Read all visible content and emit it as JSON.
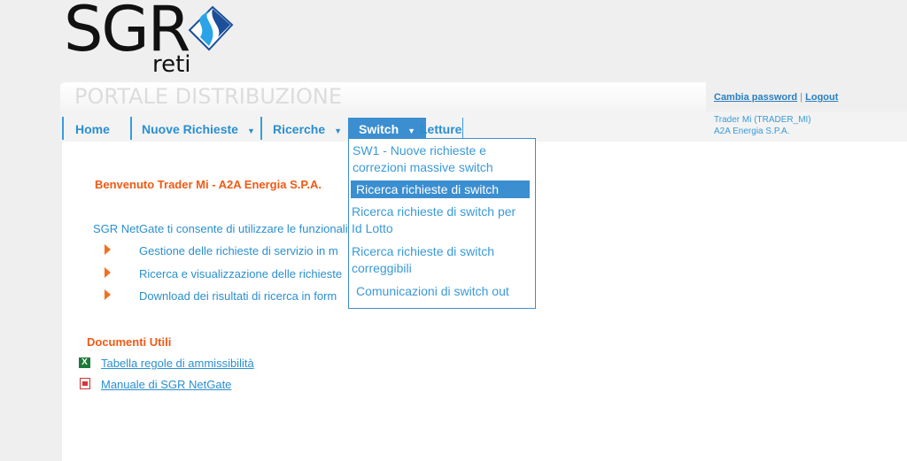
{
  "logo": {
    "text": "SGR",
    "subtext": "reti"
  },
  "header": {
    "portal_title": "PORTALE DISTRIBUZIONE",
    "change_password": "Cambia password",
    "separator": "|",
    "logout": "Logout",
    "user_name": "Trader Mi (TRADER_MI)",
    "company": "A2A Energia S.P.A."
  },
  "nav": {
    "home": "Home",
    "nuove": "Nuove Richieste",
    "ricerche": "Ricerche",
    "switch": "Switch",
    "letture": "Letture"
  },
  "switch_menu": [
    "SW1 - Nuove richieste e correzioni massive switch",
    "Ricerca richieste di switch",
    "Ricerca richieste di switch per Id Lotto",
    "Ricerca richieste di switch correggibili",
    "Comunicazioni di switch out"
  ],
  "main": {
    "welcome": "Benvenuto Trader Mi - A2A Energia S.P.A.",
    "intro": "SGR NetGate ti consente di utilizzare le funzionalità",
    "bullets": [
      "Gestione delle richieste di servizio in m",
      "Ricerca e visualizzazione delle richieste",
      "Download dei risultati di ricerca in form"
    ],
    "docs_title": "Documenti Utili",
    "docs": [
      {
        "label": "Tabella regole di ammissibilità",
        "icon": "excel-icon"
      },
      {
        "label": "Manuale di SGR NetGate",
        "icon": "pdf-icon"
      }
    ]
  },
  "colors": {
    "accent": "#3b8ed0",
    "link": "#2a8fd0",
    "orange": "#f05a14"
  }
}
